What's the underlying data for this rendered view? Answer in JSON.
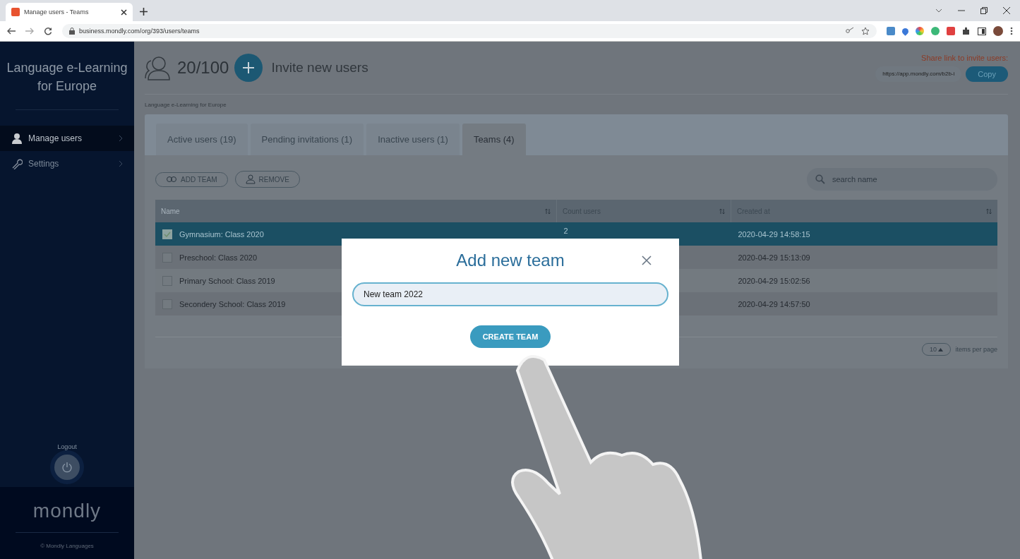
{
  "browser": {
    "tab_title": "Manage users - Teams",
    "address": "business.mondly.com/org/393/users/teams"
  },
  "sidebar": {
    "org_name": "Language e-Learning for Europe",
    "items": [
      {
        "label": "Manage users",
        "selected": true
      },
      {
        "label": "Settings",
        "selected": false
      }
    ],
    "logout": "Logout",
    "logo": "mondly",
    "footer": "© Mondly Languages"
  },
  "header": {
    "user_count": "20/100",
    "invite": "Invite new users",
    "share_label": "Share link to invite users:",
    "share_link": "https://app.mondly.com/b2b-i",
    "copy": "Copy"
  },
  "breadcrumb": "Language e-Learning for Europe",
  "tabs": [
    {
      "label": "Active users (19)",
      "selected": false
    },
    {
      "label": "Pending invitations (1)",
      "selected": false
    },
    {
      "label": "Inactive users (1)",
      "selected": false
    },
    {
      "label": "Teams (4)",
      "selected": true
    }
  ],
  "toolbar": {
    "add": "ADD TEAM",
    "remove": "REMOVE",
    "search_placeholder": "search name"
  },
  "table": {
    "columns": [
      "Name",
      "Count users",
      "Created at"
    ],
    "rows": [
      {
        "name": "Gymnasium: Class 2020",
        "count": "2",
        "created": "2020-04-29 14:58:15",
        "selected": true
      },
      {
        "name": "Preschool: Class 2020",
        "created": "2020-04-29 15:13:09",
        "selected": false
      },
      {
        "name": "Primary School: Class  2019",
        "created": "2020-04-29 15:02:56",
        "selected": false
      },
      {
        "name": "Secondery School: Class 2019",
        "created": "2020-04-29 14:57:50",
        "selected": false
      }
    ]
  },
  "pagination": {
    "page_size": "10",
    "label": "items per page"
  },
  "modal": {
    "title": "Add new team",
    "value": "New team 2022",
    "button": "CREATE TEAM"
  }
}
